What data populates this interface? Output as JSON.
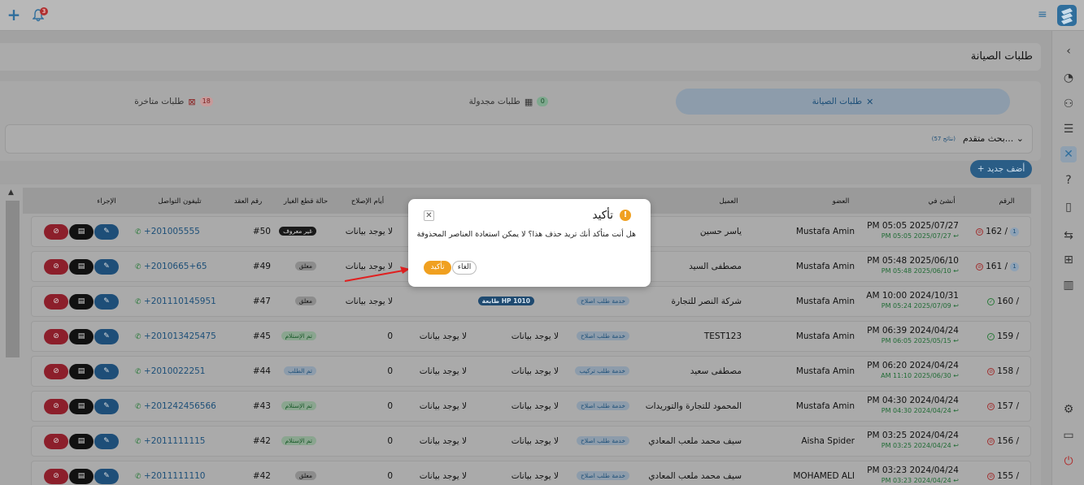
{
  "topbar": {
    "notif_count": "3"
  },
  "page": {
    "title": "طلبات الصيانة"
  },
  "tabs": [
    {
      "label": "طلبات الصيانة",
      "count": "",
      "icon": "tools-icon"
    },
    {
      "label": "طلبات مجدولة",
      "count": "0",
      "icon": "calendar-icon"
    },
    {
      "label": "طلبات متاخرة",
      "count": "18",
      "icon": "calendar-x-icon"
    }
  ],
  "search": {
    "label": "بحث متقدم...",
    "count": "(57 نتائج)"
  },
  "add_button": "+ أضف جديد",
  "table": {
    "headers": [
      "الرقم",
      "أنشئ في",
      "العضو",
      "العميل",
      "أيام الإصلاح",
      "حالة قطع الغيار",
      "رقم العقد",
      "تليفون التواصل",
      "الإجراء"
    ],
    "rows": [
      {
        "num": "162 /",
        "status": "red",
        "sub": "1",
        "created": "PM 05:05 2025/07/27",
        "updated": "PM 05:05 2025/07/27 ↩",
        "member": "Mustafa Amin",
        "client": "ياسر حسين",
        "service": "",
        "printer": "",
        "nodata1": "",
        "nodata2": "",
        "days": "لا يوجد بيانات",
        "part": "غير معروف",
        "part_style": "dark",
        "contract": "#50",
        "phone": "+201005555"
      },
      {
        "num": "161 /",
        "status": "red",
        "sub": "1",
        "created": "PM 05:48 2025/06/10",
        "updated": "PM 05:48 2025/06/10 ↩",
        "member": "Mustafa Amin",
        "client": "مصطفى السيد",
        "service": "",
        "printer": "",
        "nodata1": "",
        "nodata2": "",
        "days": "لا يوجد بيانات",
        "part": "معلق",
        "part_style": "grey",
        "contract": "#49",
        "phone": "+2010665+65"
      },
      {
        "num": "160 /",
        "status": "green",
        "sub": "",
        "created": "AM 10:00 2024/10/31",
        "updated": "PM 05:24 2025/07/09 ↩",
        "member": "Mustafa Amin",
        "client": "شركة النصر للتجارة",
        "service": "خدمة طلب اصلاح",
        "printer": "طابعة HP 1010",
        "nodata1": "",
        "nodata2": "",
        "days": "لا يوجد بيانات",
        "part": "معلق",
        "part_style": "grey",
        "contract": "#47",
        "phone": "+201110145951"
      },
      {
        "num": "159 /",
        "status": "green",
        "sub": "",
        "created": "PM 06:39 2024/04/24",
        "updated": "PM 06:05 2025/05/15 ↩",
        "member": "Mustafa Amin",
        "client": "TEST123",
        "service": "خدمة طلب اصلاح",
        "printer": "",
        "nodata1": "لا يوجد بيانات",
        "nodata2": "لا يوجد بيانات",
        "days": "0",
        "part": "تم الإستلام",
        "part_style": "green",
        "contract": "#45",
        "phone": "+201013425475"
      },
      {
        "num": "158 /",
        "status": "red",
        "sub": "",
        "created": "PM 06:20 2024/04/24",
        "updated": "AM 11:10 2025/06/30 ↩",
        "member": "Mustafa Amin",
        "client": "مصطفى سعيد",
        "service": "خدمة طلب تركيب",
        "printer": "",
        "nodata1": "لا يوجد بيانات",
        "nodata2": "لا يوجد بيانات",
        "days": "0",
        "part": "تم الطلب",
        "part_style": "blue",
        "contract": "#44",
        "phone": "+2010022251"
      },
      {
        "num": "157 /",
        "status": "red",
        "sub": "",
        "created": "PM 04:30 2024/04/24",
        "updated": "PM 04:30 2024/04/24 ↩",
        "member": "Mustafa Amin",
        "client": "المحمود للتجارة والتوريدات",
        "service": "خدمة طلب اصلاح",
        "printer": "",
        "nodata1": "لا يوجد بيانات",
        "nodata2": "لا يوجد بيانات",
        "days": "0",
        "part": "تم الإستلام",
        "part_style": "green",
        "contract": "#43",
        "phone": "+201242456566"
      },
      {
        "num": "156 /",
        "status": "red",
        "sub": "",
        "created": "PM 03:25 2024/04/24",
        "updated": "PM 03:25 2024/04/24 ↩",
        "member": "Aisha Spider",
        "client": "سيف محمد ملعب المعادي",
        "service": "خدمة طلب اصلاح",
        "printer": "",
        "nodata1": "لا يوجد بيانات",
        "nodata2": "لا يوجد بيانات",
        "days": "0",
        "part": "تم الإستلام",
        "part_style": "green",
        "contract": "#42",
        "phone": "+2011111115"
      },
      {
        "num": "155 /",
        "status": "red",
        "sub": "",
        "created": "PM 03:23 2024/04/24",
        "updated": "PM 03:23 2024/04/24 ↩",
        "member": "MOHAMED ALI",
        "client": "سيف محمد ملعب المعادي",
        "service": "خدمة طلب اصلاح",
        "printer": "",
        "nodata1": "لا يوجد بيانات",
        "nodata2": "لا يوجد بيانات",
        "days": "0",
        "part": "معلق",
        "part_style": "grey",
        "contract": "#42",
        "phone": "+2011111110"
      }
    ]
  },
  "modal": {
    "title": "تأكيد",
    "message": "هل أنت متأكد أنك تريد حذف هذا؟ لا يمكن استعادة العناصر المحذوفة",
    "cancel": "الغاء",
    "confirm": "تأكيد"
  },
  "colors": {
    "accent": "#2f6e9c",
    "warning": "#f0a020",
    "danger": "#8c1f2b",
    "arrow": "#e02020"
  }
}
